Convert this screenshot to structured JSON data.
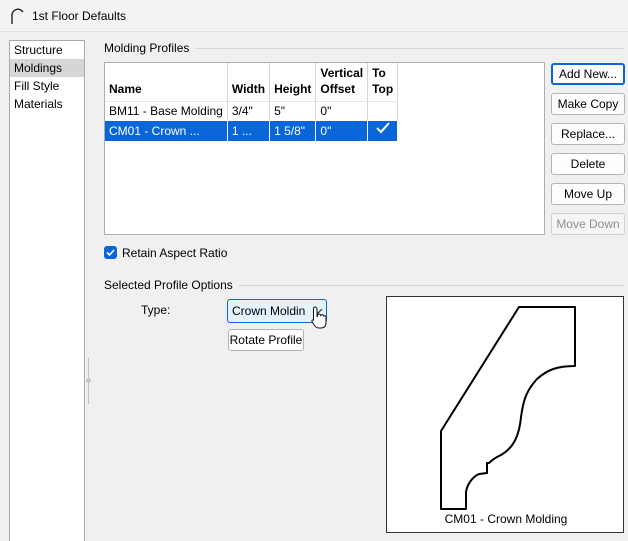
{
  "window": {
    "title": "1st Floor Defaults",
    "icon": "arch-icon"
  },
  "sidebar": {
    "items": [
      {
        "label": "Structure",
        "selected": false
      },
      {
        "label": "Moldings",
        "selected": true
      },
      {
        "label": "Fill Style",
        "selected": false
      },
      {
        "label": "Materials",
        "selected": false
      }
    ]
  },
  "molding_profiles": {
    "group_label": "Molding Profiles",
    "columns": [
      "Name",
      "Width",
      "Height",
      "Vertical Offset",
      "To Top"
    ],
    "columns_display": {
      "name": "Name",
      "width": "Width",
      "height": "Height",
      "vertical_offset_1": "Vertical",
      "vertical_offset_2": "Offset",
      "to_top_1": "To",
      "to_top_2": "Top"
    },
    "rows": [
      {
        "name": "BM11 - Base Molding",
        "width": "3/4\"",
        "height": "5\"",
        "vertical_offset": "0\"",
        "to_top": false,
        "selected": false
      },
      {
        "name": "CM01 - Crown ...",
        "width": "1 ...",
        "height": "1 5/8\"",
        "vertical_offset": "0\"",
        "to_top": true,
        "selected": true
      }
    ],
    "check_glyph": "✓"
  },
  "buttons": {
    "add_new": "Add New...",
    "make_copy": "Make Copy",
    "replace": "Replace...",
    "delete": "Delete",
    "move_up": "Move Up",
    "move_down": "Move Down"
  },
  "retain_aspect_ratio": {
    "label": "Retain Aspect Ratio",
    "checked": true
  },
  "profile_options": {
    "group_label": "Selected Profile Options",
    "type_label": "Type:",
    "type_value": "Crown Moldin",
    "rotate_button": "Rotate Profile"
  },
  "preview": {
    "caption": "CM01 - Crown Molding"
  },
  "colors": {
    "accent": "#0a66d8",
    "selection": "#0a66d8",
    "window_bg": "#f0f0f0"
  }
}
